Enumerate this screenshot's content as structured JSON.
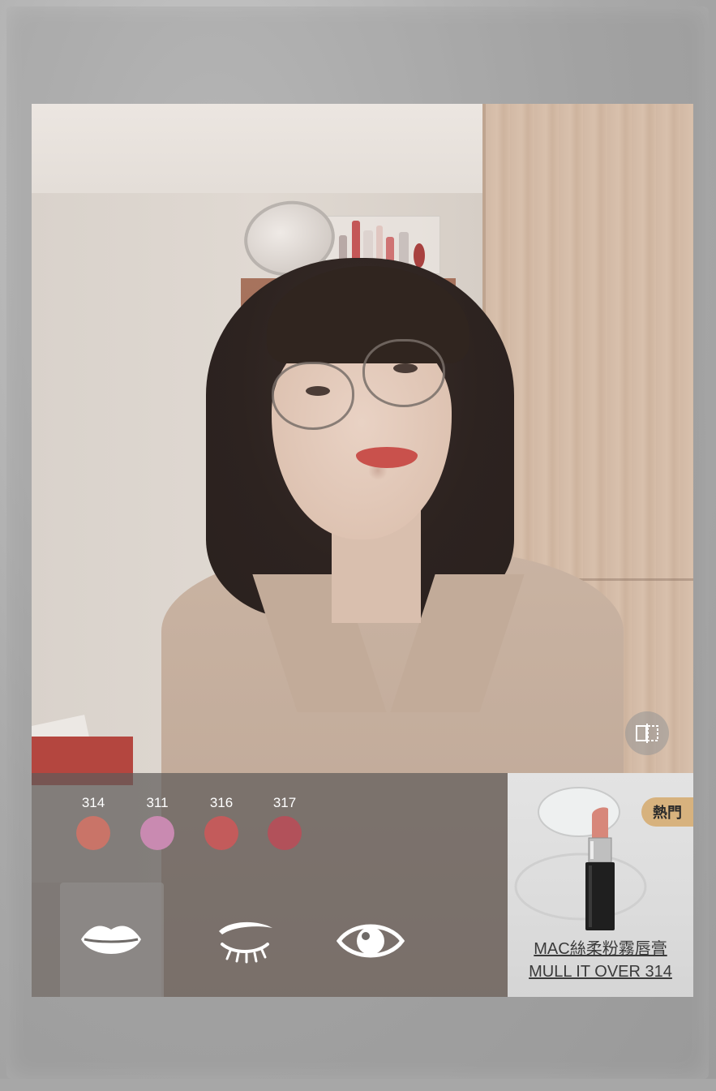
{
  "shades": [
    {
      "code": "314",
      "color": "#c97468"
    },
    {
      "code": "311",
      "color": "#c98ab1"
    },
    {
      "code": "316",
      "color": "#c35b5b"
    },
    {
      "code": "317",
      "color": "#b2515a"
    }
  ],
  "categories": [
    {
      "icon": "lips-icon",
      "active": true
    },
    {
      "icon": "eyebrow-icon",
      "active": false
    },
    {
      "icon": "eye-icon",
      "active": false
    }
  ],
  "product": {
    "badge": "熱門",
    "name_line1": "MAC絲柔粉霧唇膏",
    "name_line2": "MULL IT OVER 314"
  },
  "colors": {
    "panel_bg": "#5f5c5a",
    "badge_bg": "#d7b27e",
    "lipstick_color": "#d7877a"
  }
}
